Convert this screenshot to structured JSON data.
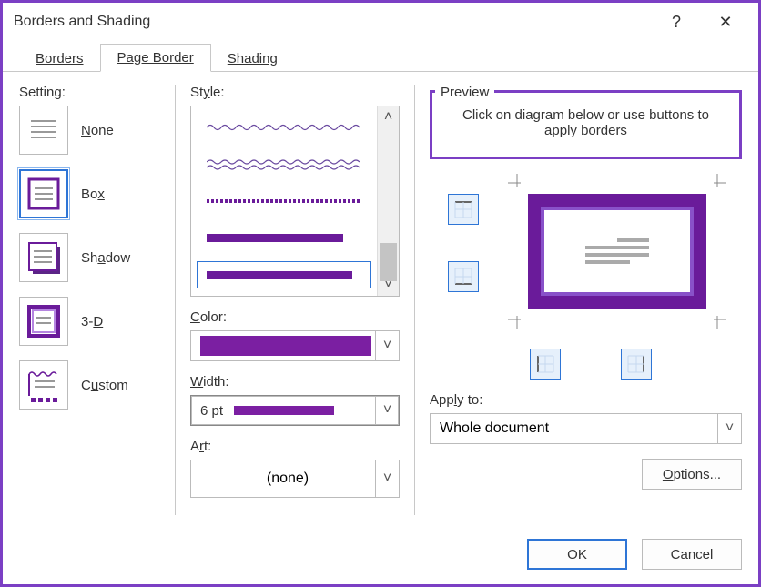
{
  "titlebar": {
    "title": "Borders and Shading",
    "help_symbol": "?",
    "close_symbol": "✕"
  },
  "tabs": {
    "borders": "Borders",
    "pageborder": "Page Border",
    "shading": "Shading",
    "active": "pageborder"
  },
  "setting": {
    "label": "Setting:",
    "items": [
      {
        "id": "none",
        "label": "None"
      },
      {
        "id": "box",
        "label": "Box"
      },
      {
        "id": "shadow",
        "label": "Shadow"
      },
      {
        "id": "3d",
        "label": "3-D"
      },
      {
        "id": "custom",
        "label": "Custom"
      }
    ],
    "selected": "box"
  },
  "style": {
    "label": "Style:"
  },
  "color": {
    "label": "Color:",
    "value": "#7b1fa2"
  },
  "width": {
    "label": "Width:",
    "value": "6 pt"
  },
  "art": {
    "label": "Art:",
    "value": "(none)"
  },
  "preview": {
    "group_label": "Preview",
    "hint": "Click on diagram below or use buttons to apply borders"
  },
  "applyto": {
    "label": "Apply to:",
    "value": "Whole document"
  },
  "options": {
    "label": "Options..."
  },
  "footer": {
    "ok": "OK",
    "cancel": "Cancel"
  }
}
